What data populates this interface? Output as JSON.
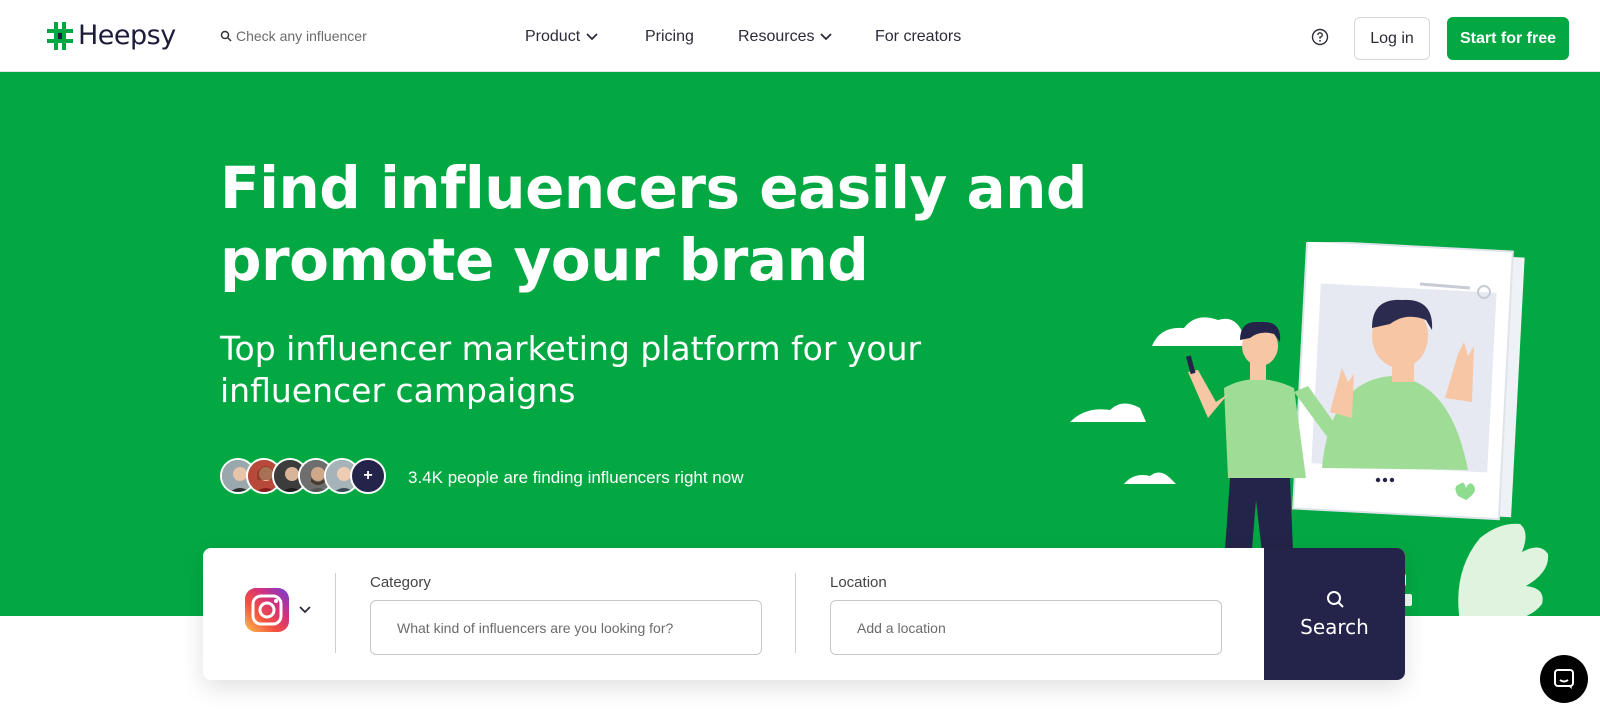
{
  "brand": {
    "name": "Heepsy",
    "accent": "#03a843",
    "dark": "#24244a"
  },
  "nav": {
    "search_placeholder": "Check any influencer",
    "links": [
      {
        "label": "Product",
        "has_dropdown": true
      },
      {
        "label": "Pricing",
        "has_dropdown": false
      },
      {
        "label": "Resources",
        "has_dropdown": true
      },
      {
        "label": "For creators",
        "has_dropdown": false
      }
    ],
    "login_label": "Log in",
    "start_label": "Start for free"
  },
  "hero": {
    "title": "Find influencers easily and promote your brand",
    "subtitle": "Top influencer marketing platform for your influencer campaigns",
    "social_proof": "3.4K people are finding influencers right now",
    "avatar_plus": "+"
  },
  "search": {
    "platform_icon": "instagram-icon",
    "category_label": "Category",
    "category_placeholder": "What kind of influencers are you looking for?",
    "location_label": "Location",
    "location_placeholder": "Add a location",
    "button_label": "Search"
  },
  "chat": {
    "icon": "chat-icon"
  }
}
